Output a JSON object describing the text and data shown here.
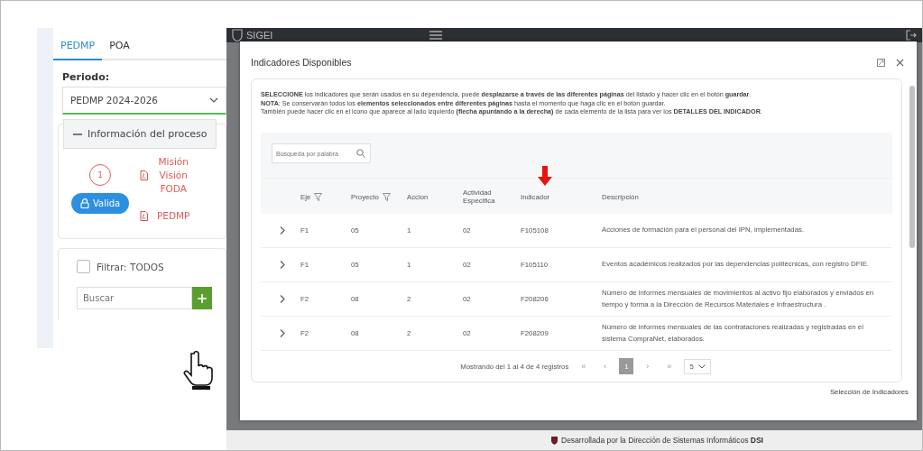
{
  "left_panel": {
    "tabs": [
      {
        "label": "PEDMP",
        "selected": true
      },
      {
        "label": "POA",
        "selected": false
      }
    ],
    "period_label": "Periodo:",
    "period_value": "PEDMP 2024-2026",
    "process": {
      "title": "Información del proceso",
      "expanded": true,
      "step": "1",
      "validate_button": "Valida",
      "documents": [
        "Misión Visión FODA",
        "PEDMP"
      ]
    },
    "filter": {
      "label": "Filtrar: TODOS",
      "checked": false
    },
    "search": {
      "placeholder": "Buscar"
    }
  },
  "app_header": {
    "title": "SIGEI"
  },
  "modal": {
    "title": "Indicadores Disponibles",
    "notice": [
      "**SELECCIONE** los indicadores que serán usados en su dependencia, puede **desplazarse a través de las diferentes páginas** del listado y hacer clic en el botón **guardar**.",
      "**NOTA**: Se conservarán todos los **elementos seleccionados entre diferentes páginas** hasta el momento que haga clic en el botón guardar.",
      "También puede hacer clic en el icono que aparece al lado izquierdo **(flecha apuntando a la derecha)** de cada elemento de la lista para ver los **DETALLES DEL INDICADOR**."
    ],
    "table_search": {
      "placeholder": "Búsqueda por palabra"
    },
    "columns": [
      {
        "label": "Eje",
        "filter": true
      },
      {
        "label": "Proyecto",
        "filter": true
      },
      {
        "label": "Accion",
        "filter": false
      },
      {
        "label": "Actividad Especifica",
        "filter": false
      },
      {
        "label": "Indicador",
        "filter": false
      },
      {
        "label": "Descripción",
        "filter": false
      }
    ],
    "rows": [
      {
        "cells": [
          "F1",
          "05",
          "1",
          "02",
          "F105108",
          "Acciones de formación para el personal del IPN, implementadas."
        ]
      },
      {
        "cells": [
          "F1",
          "05",
          "1",
          "02",
          "F105110",
          "Eventos académicos realizados por las dependencias politécnicas, con registro DFIE."
        ]
      },
      {
        "cells": [
          "F2",
          "08",
          "2",
          "02",
          "F208206",
          "Número de informes mensuales de movimientos al activo fijo elaborados y enviados en tiempo y forma a la Dirección de Recursos Materiales e Infraestructura ."
        ]
      },
      {
        "cells": [
          "F2",
          "08",
          "2",
          "02",
          "F208209",
          "Número de informes mensuales de las contrataciones realizadas y registradas en el sistema CompraNet, elaborados."
        ]
      }
    ],
    "pagination": {
      "summary": "Mostrando del 1 al 4 de 4 registros",
      "first": "«",
      "prev": "‹",
      "pages": [
        {
          "label": "1",
          "selected": true
        }
      ],
      "next": "›",
      "last": "»",
      "page_size": "5"
    },
    "footer": "Selección de Indicadores"
  },
  "footer": {
    "text": "Desarrollada por la Dirección de Sistemas Informáticos **DSI**"
  }
}
